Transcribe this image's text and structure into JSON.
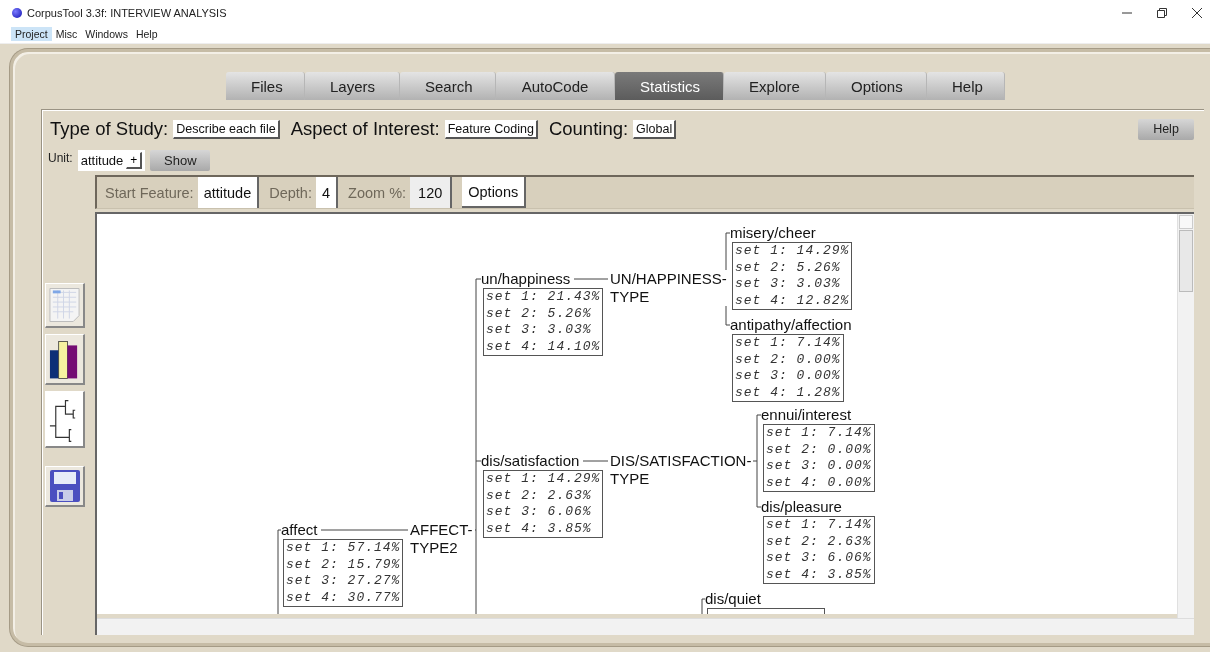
{
  "window": {
    "title": "CorpusTool 3.3f: INTERVIEW ANALYSIS"
  },
  "menu": [
    {
      "label": "Project",
      "selected": true
    },
    {
      "label": "Misc",
      "selected": false
    },
    {
      "label": "Windows",
      "selected": false
    },
    {
      "label": "Help",
      "selected": false
    }
  ],
  "tabs": [
    {
      "label": "Files",
      "selected": false
    },
    {
      "label": "Layers",
      "selected": false
    },
    {
      "label": "Search",
      "selected": false
    },
    {
      "label": "AutoCode",
      "selected": false
    },
    {
      "label": "Statistics",
      "selected": true
    },
    {
      "label": "Explore",
      "selected": false
    },
    {
      "label": "Options",
      "selected": false
    },
    {
      "label": "Help",
      "selected": false
    }
  ],
  "study_options": [
    {
      "label": "Type of Study:",
      "value": "Describe each file"
    },
    {
      "label": "Aspect of Interest:",
      "value": "Feature Coding"
    },
    {
      "label": "Counting:",
      "value": "Global"
    }
  ],
  "help_button": "Help",
  "unit": {
    "label": "Unit:",
    "value": "attitude",
    "add_button": "+"
  },
  "show_button": "Show",
  "toolbar": {
    "fields": [
      {
        "label": "Start Feature:",
        "value": "attitude"
      },
      {
        "label": "Depth:",
        "value": "4"
      },
      {
        "label": "Zoom %:",
        "value": "120"
      }
    ],
    "options_button": "Options"
  },
  "tree": {
    "label": "affect",
    "stats": [
      "set 1: 57.14%",
      "set 2: 15.79%",
      "set 3: 27.27%",
      "set 4: 30.77%"
    ],
    "system": {
      "label": "AFFECT-TYPE2",
      "children": [
        {
          "label": "un/happiness",
          "stats": [
            "set 1: 21.43%",
            "set 2: 5.26%",
            "set 3: 3.03%",
            "set 4: 14.10%"
          ],
          "system": {
            "label": "UN/HAPPINESS-TYPE",
            "children": [
              {
                "label": "misery/cheer",
                "stats": [
                  "set 1: 14.29%",
                  "set 2: 5.26%",
                  "set 3: 3.03%",
                  "set 4: 12.82%"
                ]
              },
              {
                "label": "antipathy/affection",
                "stats": [
                  "set 1: 7.14%",
                  "set 2: 0.00%",
                  "set 3: 0.00%",
                  "set 4: 1.28%"
                ]
              }
            ]
          }
        },
        {
          "label": "dis/satisfaction",
          "stats": [
            "set 1: 14.29%",
            "set 2: 2.63%",
            "set 3: 6.06%",
            "set 4: 3.85%"
          ],
          "system": {
            "label": "DIS/SATISFACTION-TYPE",
            "children": [
              {
                "label": "ennui/interest",
                "stats": [
                  "set 1: 7.14%",
                  "set 2: 0.00%",
                  "set 3: 0.00%",
                  "set 4: 0.00%"
                ]
              },
              {
                "label": "dis/pleasure",
                "stats": [
                  "set 1: 7.14%",
                  "set 2: 2.63%",
                  "set 3: 6.06%",
                  "set 4: 3.85%"
                ]
              }
            ]
          }
        }
      ]
    }
  },
  "more_nodes": [
    {
      "label": "dis/quiet"
    }
  ]
}
